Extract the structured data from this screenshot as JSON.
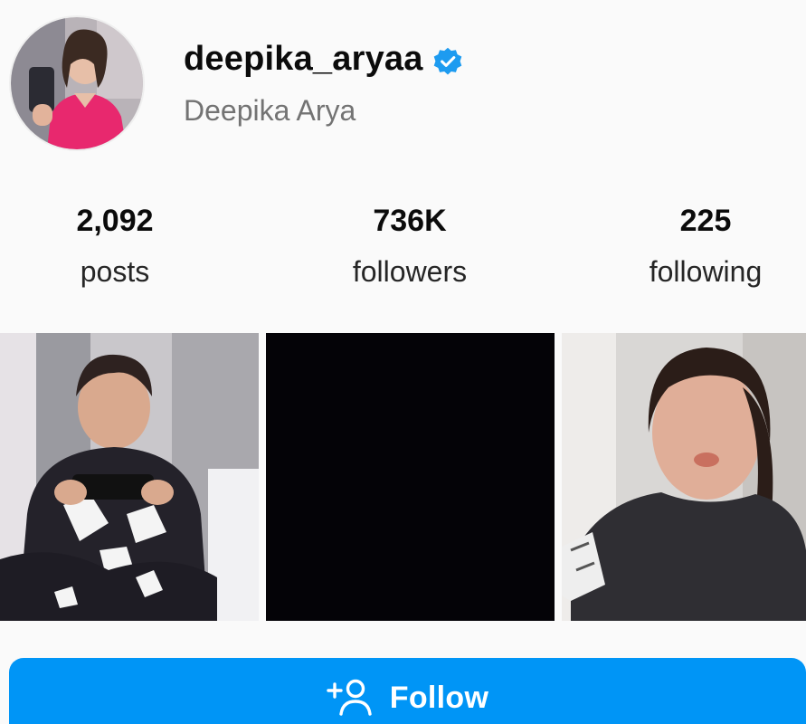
{
  "profile": {
    "username": "deepika_aryaa",
    "display_name": "Deepika Arya",
    "verified": true,
    "verified_color": "#1d9bf0",
    "avatar_icon": "profile-photo"
  },
  "stats": [
    {
      "value": "2,092",
      "label": "posts"
    },
    {
      "value": "736K",
      "label": "followers"
    },
    {
      "value": "225",
      "label": "following"
    }
  ],
  "posts": [
    {
      "thumbnail_icon": "post-thumbnail-photo"
    },
    {
      "thumbnail_icon": "post-thumbnail-black"
    },
    {
      "thumbnail_icon": "post-thumbnail-photo"
    }
  ],
  "follow_button": {
    "label": "Follow",
    "icon": "add-person-icon",
    "color": "#0095f6"
  }
}
